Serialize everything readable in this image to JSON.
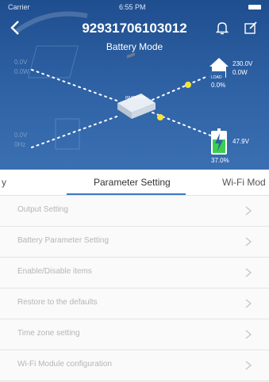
{
  "status": {
    "carrier": "Carrier",
    "time": "6:55 PM"
  },
  "header": {
    "title": "92931706103012",
    "subtitle": "Battery Mode"
  },
  "icons": {
    "back": "back-chevron-icon",
    "bell": "bell-icon",
    "edit": "edit-icon"
  },
  "diagram": {
    "inverter_label": "INVERTER",
    "load": {
      "label": "LOAD",
      "voltage": "230.0V",
      "power": "0.0W",
      "percent": "0.0%"
    },
    "battery": {
      "voltage": "47.9V",
      "percent": "37.0%"
    }
  },
  "background_faded": {
    "pv_label": "0.0V",
    "pv_power": "0.0W",
    "grid_label": "0.0V",
    "grid_freq": "0Hz"
  },
  "tabs": [
    {
      "label": "y"
    },
    {
      "label": "Parameter Setting"
    },
    {
      "label": "Wi-Fi Mod"
    }
  ],
  "menu": [
    {
      "label": "Output Setting"
    },
    {
      "label": "Battery Parameter Setting"
    },
    {
      "label": "Enable/Disable items"
    },
    {
      "label": "Restore to the defaults"
    },
    {
      "label": "Time zone setting"
    },
    {
      "label": "Wi-Fi Module configuration"
    }
  ],
  "colors": {
    "header_blue": "#2f63a6",
    "accent": "#3a78c8",
    "battery_green": "#3ccf4e",
    "flow_yellow": "#f4e43a"
  }
}
